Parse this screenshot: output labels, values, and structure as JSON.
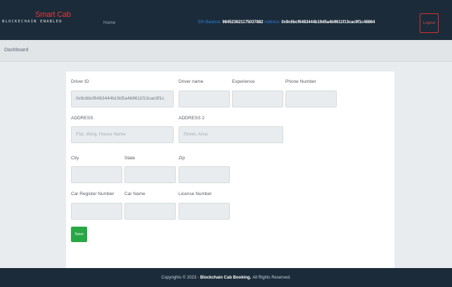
{
  "brand": {
    "title": "Smart Cab",
    "subtitle": "BLOCKECHAIN ENABLED"
  },
  "nav": {
    "home": "Home",
    "eth_balance_label": "Eth Balance:",
    "eth_balance_value": "984523621175037882",
    "address_label": "Address:",
    "address_value": "0x9c6bcf6483444b19d5a4b9611f13cac9f1c48864",
    "logout": "Logout"
  },
  "breadcrumb": {
    "current": "Dashboard"
  },
  "form": {
    "driver_id": {
      "label": "Driver ID",
      "value": "0x9c6bcf6483444b19d5a4b9611f13cac9f1c",
      "placeholder": ""
    },
    "driver_name": {
      "label": "Driver name",
      "value": "",
      "placeholder": ""
    },
    "experience": {
      "label": "Experience",
      "value": "",
      "placeholder": ""
    },
    "phone_number": {
      "label": "Phone Number",
      "value": "",
      "placeholder": ""
    },
    "address": {
      "label": "ADDRESS",
      "value": "",
      "placeholder": "Flat, Wing, House Name"
    },
    "address2": {
      "label": "ADDRESS 2",
      "value": "",
      "placeholder": "Street, Area"
    },
    "city": {
      "label": "City",
      "value": "",
      "placeholder": ""
    },
    "state": {
      "label": "State",
      "value": "",
      "placeholder": ""
    },
    "zip": {
      "label": "Zip",
      "value": "",
      "placeholder": ""
    },
    "car_register_number": {
      "label": "Car Register Number",
      "value": "",
      "placeholder": ""
    },
    "car_name": {
      "label": "Car Name",
      "value": "",
      "placeholder": ""
    },
    "license_number": {
      "label": "License Number",
      "value": "",
      "placeholder": ""
    },
    "save": "Save"
  },
  "footer": {
    "prefix": "Copyrights © 2023 -",
    "brand": "Blockchain Cab Booking.",
    "suffix": "All Rights Reserved."
  },
  "colors": {
    "navbar_bg": "#1b2b39",
    "brand_red": "#e53935",
    "label_blue": "#2f7fd8",
    "save_green": "#28a745"
  }
}
